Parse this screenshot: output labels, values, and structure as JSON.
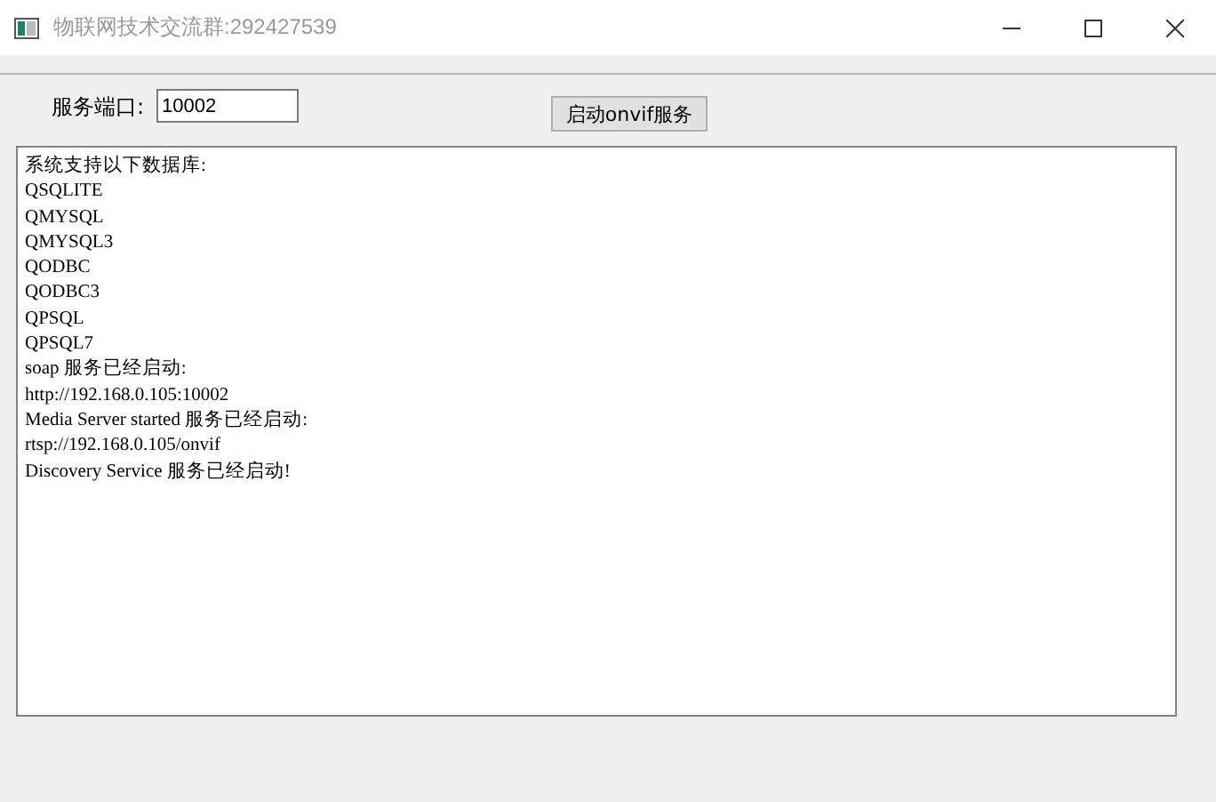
{
  "window": {
    "title": "物联网技术交流群:292427539"
  },
  "port": {
    "label": "服务端口:",
    "value": "10002"
  },
  "start_button": {
    "label": "启动onvif服务"
  },
  "log": {
    "lines": [
      "系统支持以下数据库:",
      "QSQLITE",
      "QMYSQL",
      "QMYSQL3",
      "QODBC",
      "QODBC3",
      "QPSQL",
      "QPSQL7",
      "soap 服务已经启动:",
      "http://192.168.0.105:10002",
      "Media Server started 服务已经启动:",
      "rtsp://192.168.0.105/onvif",
      "Discovery Service 服务已经启动!"
    ]
  }
}
